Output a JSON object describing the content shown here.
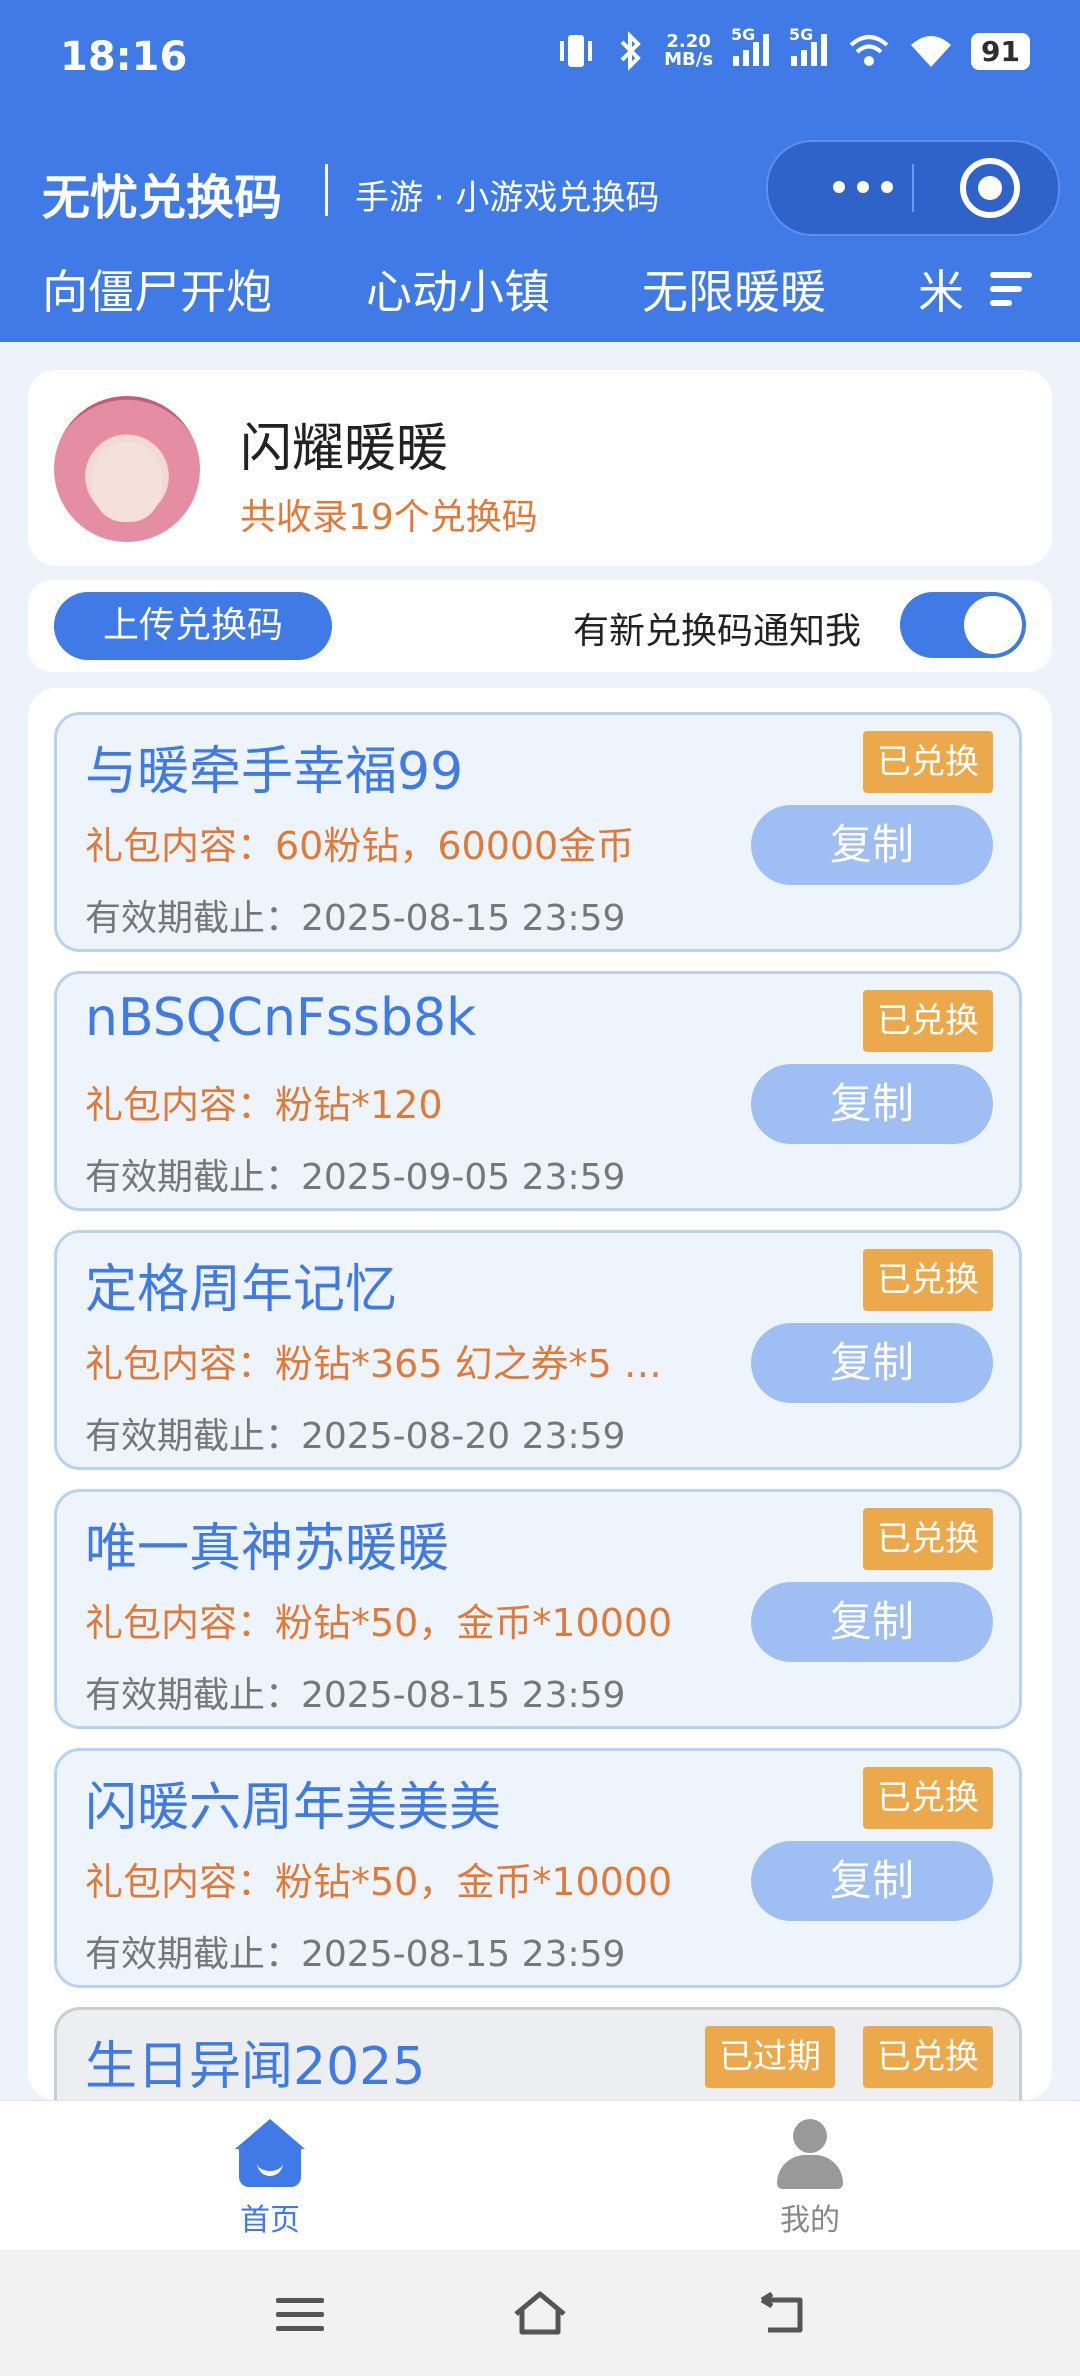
{
  "status_bar": {
    "time": "18:16",
    "net_speed_value": "2.20",
    "net_speed_unit": "MB/s",
    "sim1": "5G",
    "sim2": "5G",
    "battery": "91"
  },
  "header": {
    "title": "无忧兑换码",
    "subtitle": "手游 · 小游戏兑换码",
    "tabs": [
      "向僵尸开炮",
      "心动小镇",
      "无限暖暖",
      "米"
    ]
  },
  "game": {
    "name": "闪耀暖暖",
    "count_text": "共收录19个兑换码"
  },
  "actions": {
    "upload_label": "上传兑换码",
    "notify_label": "有新兑换码通知我",
    "notify_on": true
  },
  "codes": [
    {
      "code": "与暖牵手幸福99",
      "content": "礼包内容：60粉钻，60000金币",
      "expiry": "有效期截止：2025-08-15 23:59",
      "redeemed_label": "已兑换",
      "copy_label": "复制"
    },
    {
      "code": "nBSQCnFssb8k",
      "content": "礼包内容：粉钻*120",
      "expiry": "有效期截止：2025-09-05 23:59",
      "redeemed_label": "已兑换",
      "copy_label": "复制"
    },
    {
      "code": "定格周年记忆",
      "content": "礼包内容：粉钻*365 幻之券*5 …",
      "expiry": "有效期截止：2025-08-20 23:59",
      "redeemed_label": "已兑换",
      "copy_label": "复制"
    },
    {
      "code": "唯一真神苏暖暖",
      "content": "礼包内容：粉钻*50，金币*10000",
      "expiry": "有效期截止：2025-08-15 23:59",
      "redeemed_label": "已兑换",
      "copy_label": "复制"
    },
    {
      "code": "闪暖六周年美美美",
      "content": "礼包内容：粉钻*50，金币*10000",
      "expiry": "有效期截止：2025-08-15 23:59",
      "redeemed_label": "已兑换",
      "copy_label": "复制"
    },
    {
      "code": "生日异闻2025",
      "expired_label": "已过期",
      "redeemed_label": "已兑换"
    }
  ],
  "bottom_nav": {
    "home_label": "首页",
    "mine_label": "我的"
  },
  "colors": {
    "brand": "#3f7ae6",
    "accent_orange": "#e07a3b",
    "badge": "#eca94b"
  }
}
